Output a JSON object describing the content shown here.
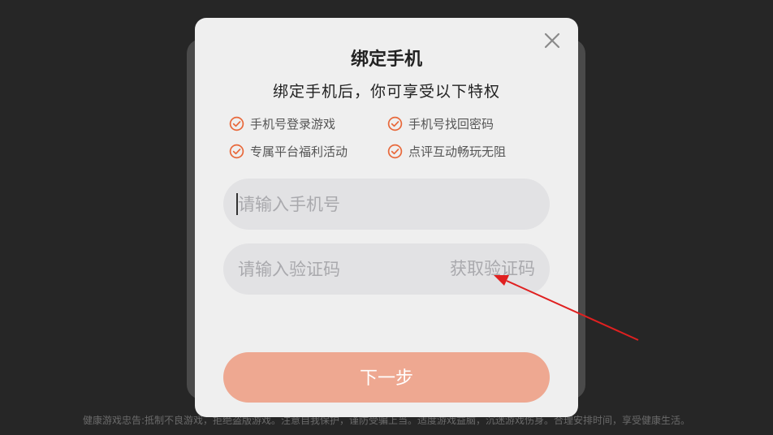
{
  "footer": {
    "notice": "健康游戏忠告:抵制不良游戏，拒绝盗版游戏。注意自我保护，谨防受骗上当。适度游戏益脑，沉迷游戏伤身。合理安排时间，享受健康生活。"
  },
  "dialog": {
    "title": "绑定手机",
    "subtitle": "绑定手机后，你可享受以下特权",
    "perks": [
      {
        "label": "手机号登录游戏",
        "icon": "check-circle-icon"
      },
      {
        "label": "手机号找回密码",
        "icon": "check-circle-icon"
      },
      {
        "label": "专属平台福利活动",
        "icon": "check-circle-icon"
      },
      {
        "label": "点评互动畅玩无阻",
        "icon": "check-circle-icon"
      }
    ],
    "phone_input": {
      "placeholder": "请输入手机号",
      "value": ""
    },
    "code_input": {
      "placeholder": "请输入验证码",
      "value": ""
    },
    "get_code_label": "获取验证码",
    "next_label": "下一步",
    "close_icon": "close-icon"
  },
  "colors": {
    "accent": "#e8683a",
    "button": "#eea891",
    "annotation_arrow": "#e02020"
  }
}
